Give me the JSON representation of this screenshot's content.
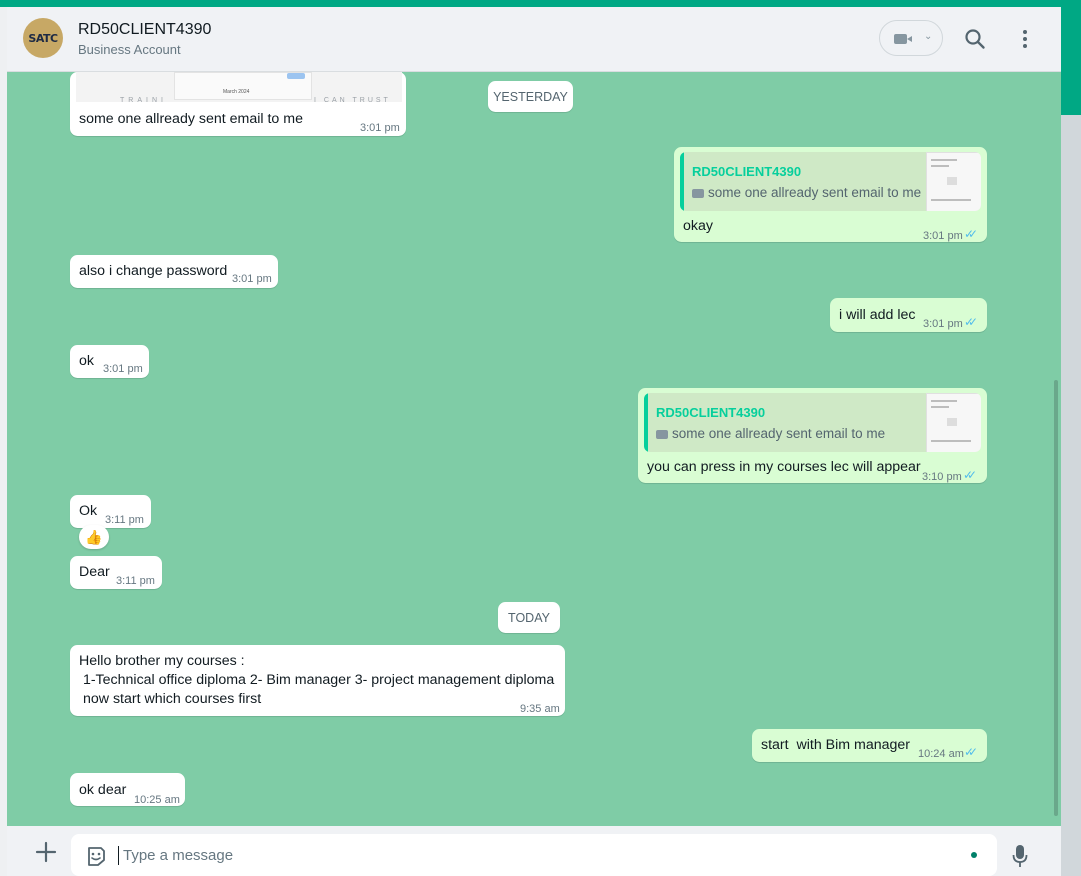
{
  "colors": {
    "accent": "#00a884",
    "chat_bg": "#7fcca6",
    "outgoing_bubble": "#d9fdd3",
    "read_tick": "#53bdeb"
  },
  "header": {
    "avatar_text": "SATC",
    "contact_name": "RD50CLIENT4390",
    "contact_status": "Business Account"
  },
  "chat": {
    "day_yesterday": "YESTERDAY",
    "day_today": "TODAY",
    "img_preview": {
      "month_label": "March 2024",
      "watermark_left": "TRAINI",
      "watermark_right": "I CAN TRUST"
    },
    "messages": [
      {
        "dir": "in",
        "text": "some one allready sent email to me",
        "time": "3:01 pm"
      },
      {
        "dir": "out",
        "quote_name": "RD50CLIENT4390",
        "quote_text": "some one allready sent email to me",
        "text": "okay",
        "time": "3:01 pm"
      },
      {
        "dir": "in",
        "text": "also i change password",
        "time": "3:01 pm"
      },
      {
        "dir": "out",
        "text": "i will add lec",
        "time": "3:01 pm"
      },
      {
        "dir": "in",
        "text": "ok",
        "time": "3:01 pm"
      },
      {
        "dir": "out",
        "quote_name": "RD50CLIENT4390",
        "quote_text": "some one allready sent email to me",
        "text": "you can press in my courses lec will appear",
        "time": "3:10 pm"
      },
      {
        "dir": "in",
        "text": "Ok",
        "time": "3:11 pm",
        "reaction": "👍"
      },
      {
        "dir": "in",
        "text": "Dear",
        "time": "3:11 pm"
      },
      {
        "dir": "in",
        "lines": [
          "Hello brother my courses :",
          " 1-Technical office diploma 2- Bim manager 3- project management diploma",
          "now start which courses first"
        ],
        "time": "9:35 am"
      },
      {
        "dir": "out",
        "text": "start  with Bim manager",
        "time": "10:24 am"
      },
      {
        "dir": "in",
        "text": "ok dear",
        "time": "10:25 am"
      }
    ]
  },
  "footer": {
    "placeholder": "Type a message"
  },
  "icons": [
    "video-call-icon",
    "chevron-down-icon",
    "search-icon",
    "menu-icon",
    "plus-icon",
    "emoji-icon",
    "mic-icon",
    "camera-icon",
    "double-tick-icon"
  ]
}
